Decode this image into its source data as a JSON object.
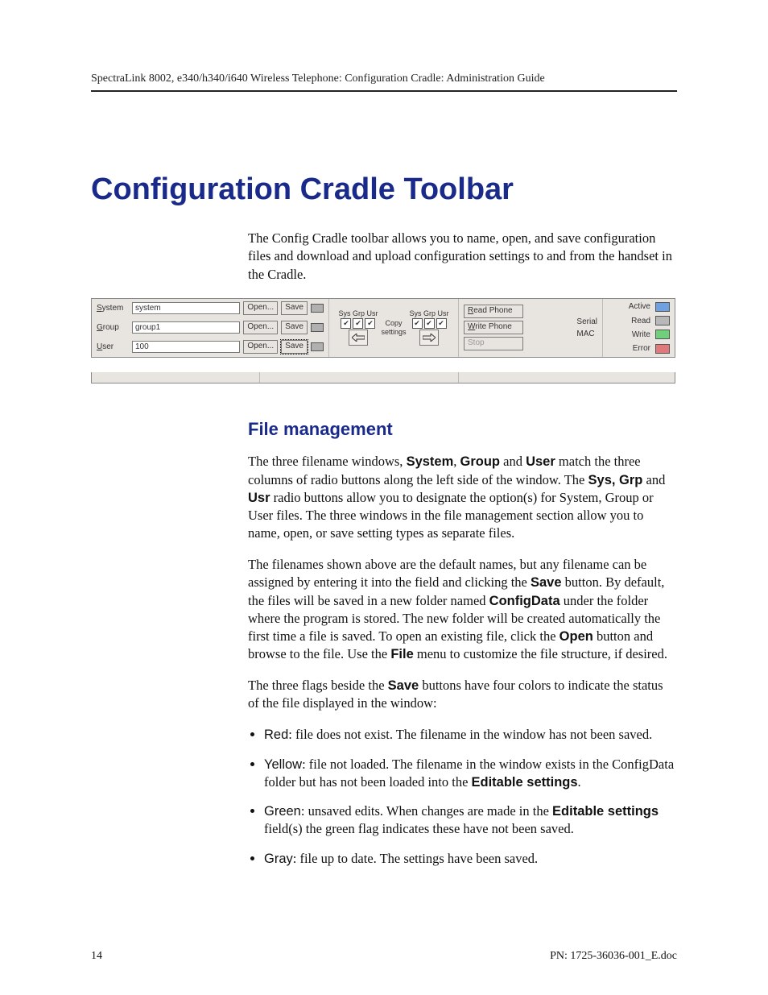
{
  "header": "SpectraLink 8002, e340/h340/i640 Wireless Telephone: Configuration Cradle: Administration Guide",
  "title": "Configuration Cradle Toolbar",
  "intro": "The Config Cradle toolbar allows you to name, open, and save configuration files and download and upload configuration settings to and from the handset in the Cradle.",
  "toolbar": {
    "rows": {
      "system": {
        "label_u": "S",
        "label_rest": "ystem",
        "value": "system",
        "open": "Open...",
        "save": "Save"
      },
      "group": {
        "label_u": "G",
        "label_rest": "roup",
        "value": "group1",
        "open": "Open...",
        "save": "Save"
      },
      "user": {
        "label_u": "U",
        "label_rest": "ser",
        "value": "100",
        "open": "Open...",
        "save": "Save"
      }
    },
    "copy": {
      "hdr_left": "Sys Grp Usr",
      "hdr_right": "Sys Grp Usr",
      "label1": "Copy",
      "label2": "settings",
      "check": "✔"
    },
    "phone": {
      "read": "Read Phone",
      "write": "Write Phone",
      "stop": "Stop",
      "serial": "Serial",
      "mac": "MAC"
    },
    "status": {
      "active": "Active",
      "read": "Read",
      "write": "Write",
      "error": "Error"
    }
  },
  "section_title": "File management",
  "p1a": "The three filename windows, ",
  "p1_b1": "System",
  "p1b": ", ",
  "p1_b2": "Group",
  "p1c": " and ",
  "p1_b3": "User",
  "p1d": " match the three columns of radio buttons along the left side of the window. The ",
  "p1_b4": "Sys, Grp",
  "p1e": " and ",
  "p1_b5": "Usr",
  "p1f": " radio buttons allow you to designate the option(s) for System, Group or User files. The three windows in the file management section allow you to name, open, or save setting types as separate files.",
  "p2a": "The filenames shown above are the default names, but any filename can be assigned by entering it into the field and clicking the ",
  "p2_b1": "Save",
  "p2b": " button. By default, the files will be saved in a new folder named ",
  "p2_b2": "ConfigData",
  "p2c": " under the folder where the program is stored. The new folder will be created automatically the first time a file is saved. To open an existing file, click the ",
  "p2_b3": "Open",
  "p2d": " button and browse to the file. Use the ",
  "p2_b4": "File",
  "p2e": " menu to customize the file structure, if desired.",
  "p3a": "The three flags beside the ",
  "p3_b1": "Save",
  "p3b": " buttons have four colors to indicate the status of the file displayed in the window:",
  "li1_h": "Red",
  "li1": ": file does not exist. The filename in the window has not been saved.",
  "li2_h": "Yellow",
  "li2a": ": file not loaded. The filename in the window exists in the ConfigData folder but has not been loaded into the ",
  "li2_b": "Editable settings",
  "li2c": ".",
  "li3_h": "Green",
  "li3a": ": unsaved edits. When changes are made in the ",
  "li3_b": "Editable settings",
  "li3c": " field(s) the green flag indicates these have not been saved.",
  "li4_h": "Gray",
  "li4": ": file up to date. The settings have been saved.",
  "footer_page": "14",
  "footer_pn": "PN: 1725-36036-001_E.doc"
}
